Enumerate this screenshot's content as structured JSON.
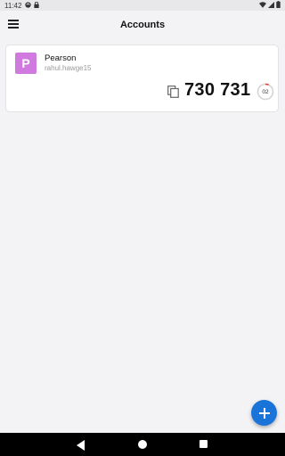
{
  "status_bar": {
    "time": "11:42",
    "icons": [
      "sync-icon",
      "lock-icon",
      "wifi-icon",
      "signal-icon",
      "battery-icon"
    ]
  },
  "app_bar": {
    "title": "Accounts",
    "menu_icon": "hamburger-menu-icon"
  },
  "accounts": [
    {
      "avatar_letter": "P",
      "avatar_color": "#d07adf",
      "name": "Pearson",
      "username": "rahul.hawge15",
      "code": "730 731",
      "seconds_remaining": "02",
      "timer_fraction_remaining": 0.07,
      "timer_color": "#e53935"
    }
  ],
  "fab": {
    "icon": "plus-icon",
    "color": "#1a73d9"
  },
  "nav_bar": {
    "icons": [
      "back-icon",
      "home-icon",
      "recents-icon"
    ]
  }
}
